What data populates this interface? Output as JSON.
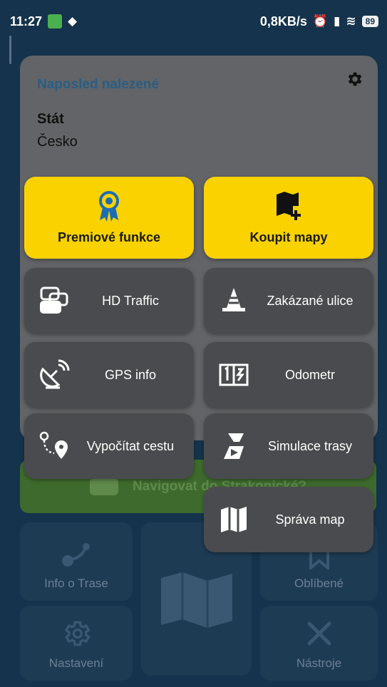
{
  "status_bar": {
    "time": "11:27",
    "network_speed": "0,8KB/s",
    "battery": "89"
  },
  "background": {
    "card_title": "Naposled nalezené",
    "state_label": "Stát",
    "state_value": "Česko",
    "nav_label": "Navigovat do Strakonické?",
    "tiles": {
      "route_info": "Info o Trase",
      "favorites": "Oblíbené",
      "settings": "Nastavení",
      "tools": "Nástroje"
    }
  },
  "menu": {
    "premium": "Premiové funkce",
    "buy_maps": "Koupit mapy",
    "hd_traffic": "HD Traffic",
    "forbidden_streets": "Zakázané ulice",
    "gps_info": "GPS info",
    "odometer": "Odometr",
    "compute_route": "Vypočítat cestu",
    "route_simulation": "Simulace trasy",
    "manage_maps": "Správa map"
  },
  "colors": {
    "premium_yellow": "#f9d200",
    "menu_gray": "#4a4b4e",
    "background_navy": "#15334c"
  }
}
